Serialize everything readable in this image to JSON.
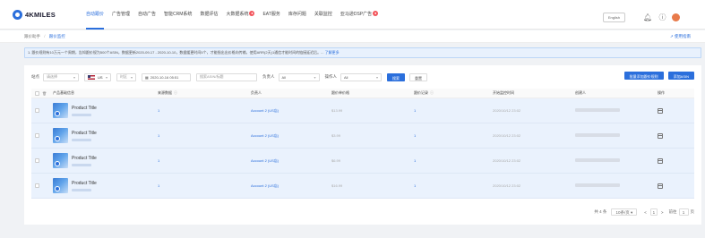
{
  "brand": {
    "name": "4KMILES",
    "accent": "#2b6fdc"
  },
  "nav": {
    "items": [
      {
        "label": "自动跟价",
        "active": true
      },
      {
        "label": "广告管理"
      },
      {
        "label": "自动广告"
      },
      {
        "label": "智能CRM系统"
      },
      {
        "label": "数据评估"
      },
      {
        "label": "大数据系统",
        "badge": "●"
      },
      {
        "label": "EAT服务"
      },
      {
        "label": "库存问题"
      },
      {
        "label": "关联监控"
      },
      {
        "label": "亚马逊DSP广告",
        "badge": "●"
      }
    ],
    "lang": "English"
  },
  "breadcrumb": {
    "root": "跟价助手",
    "sep": "/",
    "current": "跟价监控",
    "help": "使用指南"
  },
  "notice": {
    "text": "1. 跟价规则有10万元一个周期，告知跟价规为500个ASIN，数据更新2020-09-17 - 2020-10-10，数据缓更时间5个，才能指出出价格向传输，使用ARR(2天)1通信才能时间的链接延迟后。...",
    "link": "了解更多"
  },
  "filters": {
    "site_label": "站点",
    "site_value": "请选择",
    "country_value": "US",
    "date_type": "时区",
    "date_value": "2020-10-16 05:51",
    "search_placeholder": "搜索ASIN/标题",
    "owner_label": "负责人",
    "owner_value": "All",
    "operator_label": "操作人",
    "operator_value": "All",
    "search_btn": "搜索",
    "reset_btn": "重置",
    "batch_btn": "批量添加跟价规则",
    "add_btn": "添加ASIN"
  },
  "table": {
    "headers": [
      "产品基础信息",
      "来源数据",
      "负责人",
      "跟价单价格",
      "跟价记录",
      "开始监控时间",
      "创建人",
      "操作"
    ],
    "rows": [
      {
        "title": "Product Title",
        "source": "1",
        "account": "Account 2 (US店)",
        "price": "$13.99",
        "records": "1",
        "time": "2020/10/12 23:02"
      },
      {
        "title": "Product Title",
        "source": "1",
        "account": "Account 2 (US店)",
        "price": "$3.99",
        "records": "1",
        "time": "2020/10/12 23:02"
      },
      {
        "title": "Product Title",
        "source": "1",
        "account": "Account 2 (US店)",
        "price": "$6.99",
        "records": "1",
        "time": "2020/10/12 23:02"
      },
      {
        "title": "Product Title",
        "source": "1",
        "account": "Account 2 (US店)",
        "price": "$16.99",
        "records": "1",
        "time": "2020/10/12 23:02"
      }
    ]
  },
  "pagination": {
    "total": "共 4 条",
    "page_size": "10条/页",
    "prev": "<",
    "current": "1",
    "next": ">",
    "goto_label": "前往",
    "goto_value": "1",
    "page_suffix": "页"
  }
}
